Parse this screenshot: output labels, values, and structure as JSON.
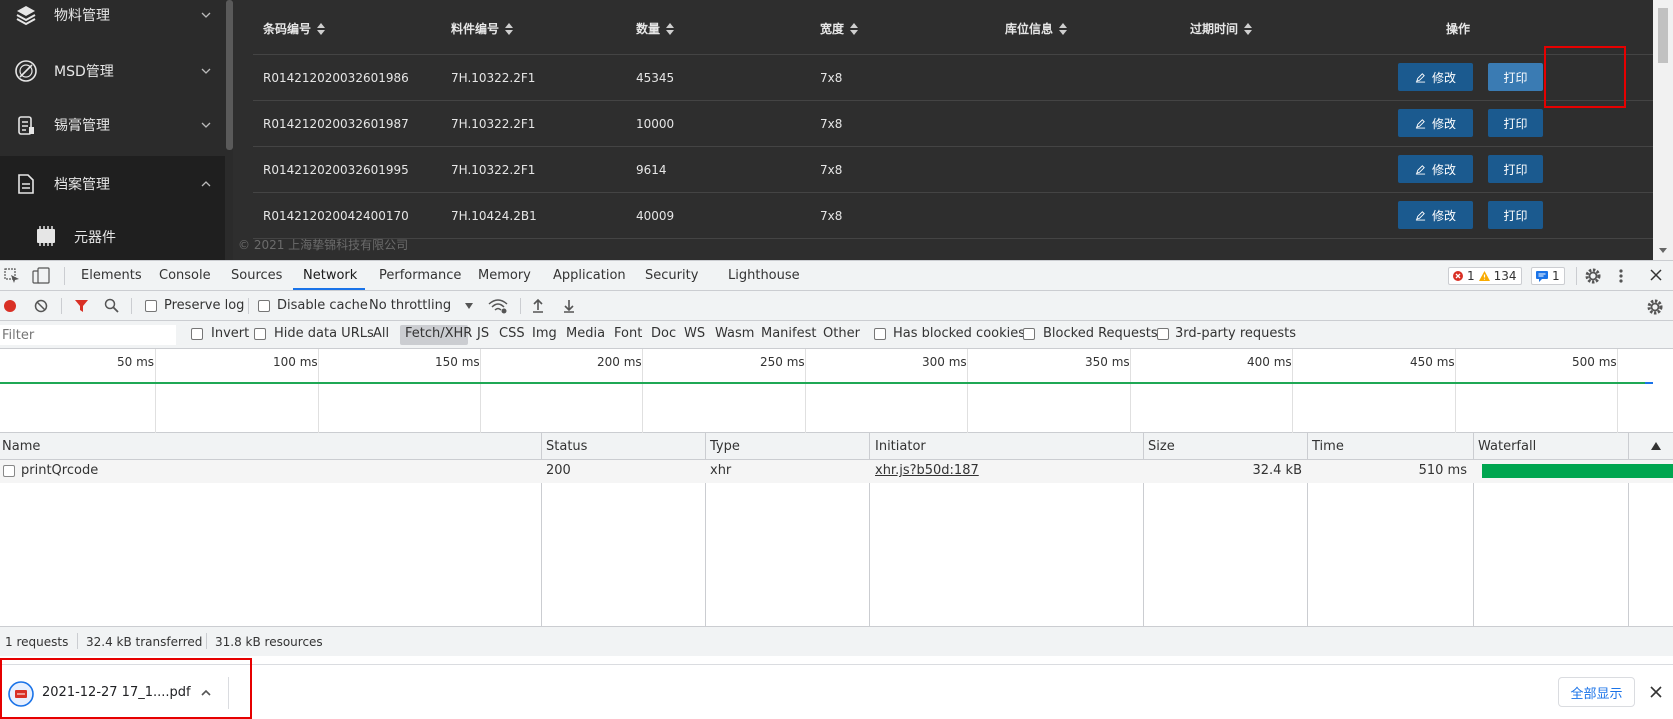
{
  "app": {
    "sidebar": {
      "items": [
        {
          "label": "物料管理",
          "icon": "layers-icon"
        },
        {
          "label": "MSD管理",
          "icon": "msd-icon"
        },
        {
          "label": "锡膏管理",
          "icon": "solder-paste-icon"
        },
        {
          "label": "档案管理",
          "icon": "document-icon"
        }
      ],
      "sub_item": {
        "label": "元器件",
        "icon": "chip-icon"
      }
    },
    "table": {
      "headers": [
        "条码编号",
        "料件编号",
        "数量",
        "宽度",
        "库位信息",
        "过期时间",
        "操作"
      ],
      "rows": [
        [
          "R014212020032601986",
          "7H.10322.2F1",
          "45345",
          "7x8"
        ],
        [
          "R014212020032601987",
          "7H.10322.2F1",
          "10000",
          "7x8"
        ],
        [
          "R014212020032601995",
          "7H.10322.2F1",
          "9614",
          "7x8"
        ],
        [
          "R014212020042400170",
          "7H.10424.2B1",
          "40009",
          "7x8"
        ]
      ],
      "edit_label": "修改",
      "print_label": "打印"
    },
    "footer": "© 2021 上海挚锦科技有限公司"
  },
  "devtools": {
    "tabs": [
      "Elements",
      "Console",
      "Sources",
      "Network",
      "Performance",
      "Memory",
      "Application",
      "Security",
      "Lighthouse"
    ],
    "active_tab": "Network",
    "badges": {
      "errors": "1",
      "warnings": "134",
      "messages": "1"
    },
    "toolbar": {
      "preserve_log": "Preserve log",
      "disable_cache": "Disable cache",
      "throttling": "No throttling"
    },
    "filter": {
      "placeholder": "Filter",
      "invert": "Invert",
      "hide_data_urls": "Hide data URLs",
      "types": [
        "All",
        "Fetch/XHR",
        "JS",
        "CSS",
        "Img",
        "Media",
        "Font",
        "Doc",
        "WS",
        "Wasm",
        "Manifest",
        "Other"
      ],
      "active_type": "Fetch/XHR",
      "has_blocked_cookies": "Has blocked cookies",
      "blocked_requests": "Blocked Requests",
      "third_party": "3rd-party requests"
    },
    "overview_ticks": [
      "50 ms",
      "100 ms",
      "150 ms",
      "200 ms",
      "250 ms",
      "300 ms",
      "350 ms",
      "400 ms",
      "450 ms",
      "500 ms"
    ],
    "grid": {
      "columns": [
        "Name",
        "Status",
        "Type",
        "Initiator",
        "Size",
        "Time",
        "Waterfall"
      ],
      "rows": [
        {
          "name": "printQrcode",
          "status": "200",
          "type": "xhr",
          "initiator": "xhr.js?b50d:187",
          "size": "32.4 kB",
          "time": "510 ms"
        }
      ]
    },
    "status": {
      "requests": "1 requests",
      "transferred": "32.4 kB transferred",
      "resources": "31.8 kB resources"
    }
  },
  "downloads": {
    "file_name": "2021-12-27 17_1....pdf",
    "show_all": "全部显示"
  },
  "colors": {
    "app_bg": "#2e2e2e",
    "button_blue": "#1b5a8f",
    "highlight_red": "#e60000",
    "devtools_accent": "#1a73e8",
    "waterfall_green": "#00a650"
  }
}
